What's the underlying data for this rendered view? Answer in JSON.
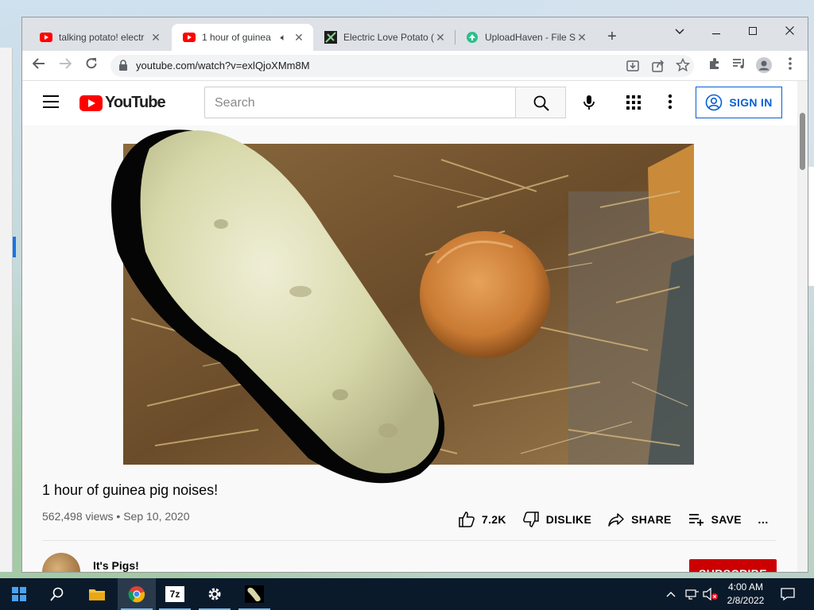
{
  "browser": {
    "tabs": [
      {
        "title": "talking potato! electr",
        "favicon": "youtube-icon",
        "active": false
      },
      {
        "title": "1 hour of guinea",
        "favicon": "youtube-icon",
        "active": true,
        "audio": "speaker-icon"
      },
      {
        "title": "Electric Love Potato (",
        "favicon": "potato-favicon",
        "active": false
      },
      {
        "title": "UploadHaven - File S",
        "favicon": "uploadhaven-icon",
        "active": false
      }
    ],
    "new_tab_symbol": "+",
    "url": "youtube.com/watch?v=exlQjoXMm8M"
  },
  "youtube": {
    "logo_text": "YouTube",
    "search_placeholder": "Search",
    "sign_in_label": "SIGN IN",
    "video": {
      "title": "1 hour of guinea pig noises!",
      "views": "562,498 views",
      "separator": "•",
      "date": "Sep 10, 2020",
      "likes": "7.2K",
      "dislike_label": "DISLIKE",
      "share_label": "SHARE",
      "save_label": "SAVE",
      "more_symbol": "…"
    },
    "channel": {
      "name": "It's Pigs!",
      "subscribe_label": "SUBSCRIBE"
    }
  },
  "taskbar": {
    "apps": [
      "windows-start-icon",
      "search-icon",
      "file-explorer-icon",
      "chrome-icon",
      "7zip-icon",
      "settings-gear-icon",
      "potato-app-icon"
    ],
    "seven_zip_label": "7z",
    "time": "4:00 AM",
    "date": "2/8/2022"
  },
  "colors": {
    "youtube_red": "#ff0000",
    "sign_in_blue": "#065fd4",
    "subscribe_red": "#cc0000",
    "taskbar": "#0b1a2b"
  }
}
